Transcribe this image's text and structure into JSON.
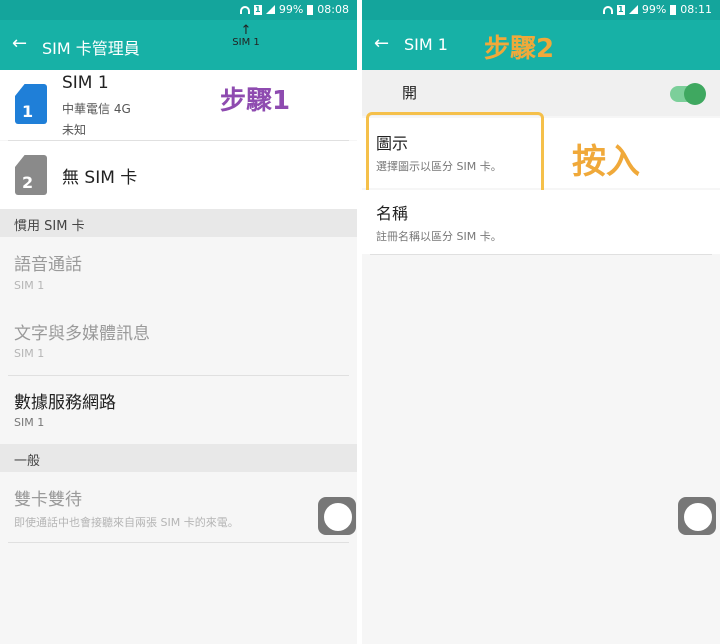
{
  "screen1": {
    "status": {
      "sim": "1",
      "battery": "99%",
      "time": "08:08"
    },
    "appbar": {
      "title": "SIM 卡管理員"
    },
    "sim1": {
      "name": "SIM 1",
      "carrier": "中華電信 4G",
      "number": "未知",
      "badge": "1"
    },
    "sim2": {
      "name": "無 SIM 卡",
      "badge": "2"
    },
    "section_preferred": "慣用 SIM 卡",
    "voice": {
      "label": "語音通話",
      "sub": "SIM 1"
    },
    "sms": {
      "label": "文字與多媒體訊息",
      "sub": "SIM 1"
    },
    "data": {
      "label": "數據服務網路",
      "sub": "SIM 1"
    },
    "section_general": "一般",
    "dual": {
      "label": "雙卡雙待",
      "sub": "即使通話中也會接聽來自兩張 SIM 卡的來電。"
    },
    "annotation_step": "步驟1",
    "annotation_sim": "SIM 1"
  },
  "screen2": {
    "status": {
      "sim": "1",
      "battery": "99%",
      "time": "08:11"
    },
    "appbar": {
      "title": "SIM 1"
    },
    "toggle_row": {
      "label": "開"
    },
    "icon_row": {
      "label": "圖示",
      "sub": "選擇圖示以區分 SIM 卡。"
    },
    "name_row": {
      "label": "名稱",
      "sub": "註冊名稱以區分 SIM 卡。"
    },
    "annotation_step": "步驟2",
    "annotation_press": "按入"
  },
  "colors": {
    "appbar": "#17b1a6",
    "statusbar": "#14a59c",
    "sim1_blue": "#1f7fd8",
    "sim2_gray": "#8a8a8a",
    "annot_purple": "#8e4bb0",
    "annot_orange": "#f0a93a"
  },
  "icons": [
    "back-arrow-icon",
    "wifi-icon",
    "signal-icon",
    "battery-icon",
    "sim-card-icon",
    "floating-home-button-icon"
  ]
}
